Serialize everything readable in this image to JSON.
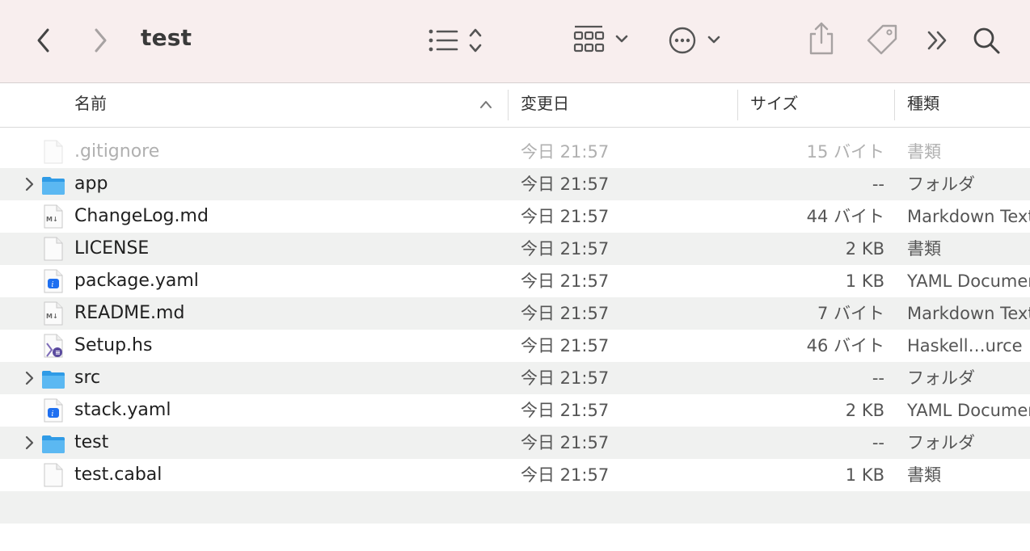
{
  "toolbar": {
    "title": "test",
    "icons": [
      "chevron-left-icon",
      "chevron-right-icon",
      "list-sort-icon",
      "grid-view-icon",
      "more-actions-icon",
      "share-icon",
      "tag-icon",
      "overflow-icon",
      "search-icon"
    ]
  },
  "columns": {
    "name": "名前",
    "date": "変更日",
    "size": "サイズ",
    "kind": "種類"
  },
  "files": [
    {
      "name": ".gitignore",
      "date": "今日 21:57",
      "size": "15 バイト",
      "kind": "書類",
      "type": "doc",
      "dim": true
    },
    {
      "name": "app",
      "date": "今日 21:57",
      "size": "--",
      "kind": "フォルダ",
      "type": "folder"
    },
    {
      "name": "ChangeLog.md",
      "date": "今日 21:57",
      "size": "44 バイト",
      "kind": "Markdown Text",
      "type": "md"
    },
    {
      "name": "LICENSE",
      "date": "今日 21:57",
      "size": "2 KB",
      "kind": "書類",
      "type": "doc"
    },
    {
      "name": "package.yaml",
      "date": "今日 21:57",
      "size": "1 KB",
      "kind": "YAML Document",
      "type": "yaml"
    },
    {
      "name": "README.md",
      "date": "今日 21:57",
      "size": "7 バイト",
      "kind": "Markdown Text",
      "type": "md"
    },
    {
      "name": "Setup.hs",
      "date": "今日 21:57",
      "size": "46 バイト",
      "kind": "Haskell…urce",
      "type": "hs"
    },
    {
      "name": "src",
      "date": "今日 21:57",
      "size": "--",
      "kind": "フォルダ",
      "type": "folder"
    },
    {
      "name": "stack.yaml",
      "date": "今日 21:57",
      "size": "2 KB",
      "kind": "YAML Document",
      "type": "yaml"
    },
    {
      "name": "test",
      "date": "今日 21:57",
      "size": "--",
      "kind": "フォルダ",
      "type": "folder"
    },
    {
      "name": "test.cabal",
      "date": "今日 21:57",
      "size": "1 KB",
      "kind": "書類",
      "type": "doc"
    }
  ]
}
